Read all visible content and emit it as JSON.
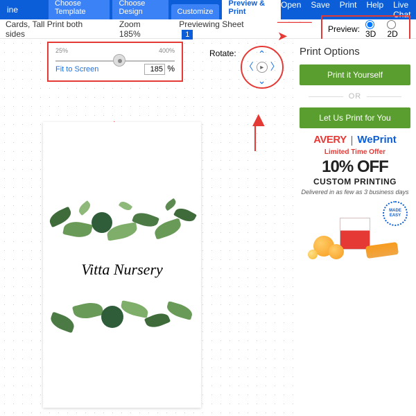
{
  "topbar": {
    "partial": "ine",
    "tabs": [
      "Choose Template",
      "Choose Design",
      "Customize",
      "Preview & Print"
    ],
    "active_tab": 3,
    "menu": [
      "Open",
      "Save",
      "Print",
      "Help",
      "Live Chat"
    ]
  },
  "toolbar": {
    "desc": "Cards, Tall Print both sides",
    "zoom_label": "Zoom",
    "zoom_value": "185%",
    "previewing": "Previewing Sheet",
    "sheet_num": "1",
    "preview_label": "Preview:",
    "option_3d": "3D",
    "option_2d": "2D",
    "preview_mode": "3D"
  },
  "zoom_panel": {
    "min": "25%",
    "max": "400%",
    "fit": "Fit to Screen",
    "value": "185",
    "suffix": "%"
  },
  "rotate_label": "Rotate:",
  "card": {
    "title": "Vitta Nursery"
  },
  "right": {
    "heading": "Print Options",
    "btn_self": "Print it Yourself",
    "or": "OR",
    "btn_us": "Let Us Print for You",
    "avery": "AVERY",
    "weprint": "WePrint",
    "lto": "Limited Time Offer",
    "pct": "10% OFF",
    "cp": "CUSTOM PRINTING",
    "delivery": "Delivered in as few as 3 business days",
    "seal": "MADE EASY"
  }
}
